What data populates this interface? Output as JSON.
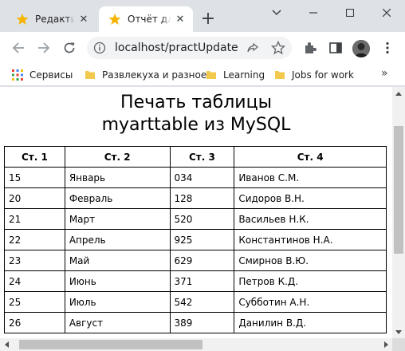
{
  "browser": {
    "tabs": [
      {
        "title": "Редактир",
        "icon": "star-favicon",
        "active": false
      },
      {
        "title": "Отчёт для",
        "icon": "star-favicon",
        "active": true
      }
    ],
    "new_tab_icon": "plus-icon",
    "window_controls": [
      "chevron-down-icon",
      "minimize-icon",
      "maximize-icon",
      "close-icon"
    ],
    "url": "localhost/practUpdate",
    "bookmarks": [
      {
        "label": "Сервисы",
        "icon": "apps-grid-icon"
      },
      {
        "label": "Развлекуха и разное",
        "icon": "folder-icon"
      },
      {
        "label": "Learning",
        "icon": "folder-icon"
      },
      {
        "label": "Jobs for work",
        "icon": "folder-icon"
      }
    ],
    "bookmarks_more": "»",
    "colors": {
      "frame": "#dee1e6",
      "folder": "#f2c94c",
      "star": "#f5b400"
    }
  },
  "page": {
    "heading_line1": "Печать таблицы",
    "heading_line2": "myarttable из MySQL",
    "table": {
      "headers": [
        "Ст. 1",
        "Ст. 2",
        "Ст. 3",
        "Ст. 4"
      ],
      "rows": [
        [
          "15",
          "Январь",
          "034",
          "Иванов С.М."
        ],
        [
          "20",
          "Февраль",
          "128",
          "Сидоров В.Н."
        ],
        [
          "21",
          "Март",
          "520",
          "Васильев Н.К."
        ],
        [
          "22",
          "Апрель",
          "925",
          "Константинов Н.А."
        ],
        [
          "23",
          "Май",
          "629",
          "Смирнов В.Ю."
        ],
        [
          "24",
          "Июнь",
          "371",
          "Петров К.Д."
        ],
        [
          "25",
          "Июль",
          "542",
          "Субботин А.Н."
        ],
        [
          "26",
          "Август",
          "389",
          "Данилин В.Д."
        ]
      ]
    }
  }
}
